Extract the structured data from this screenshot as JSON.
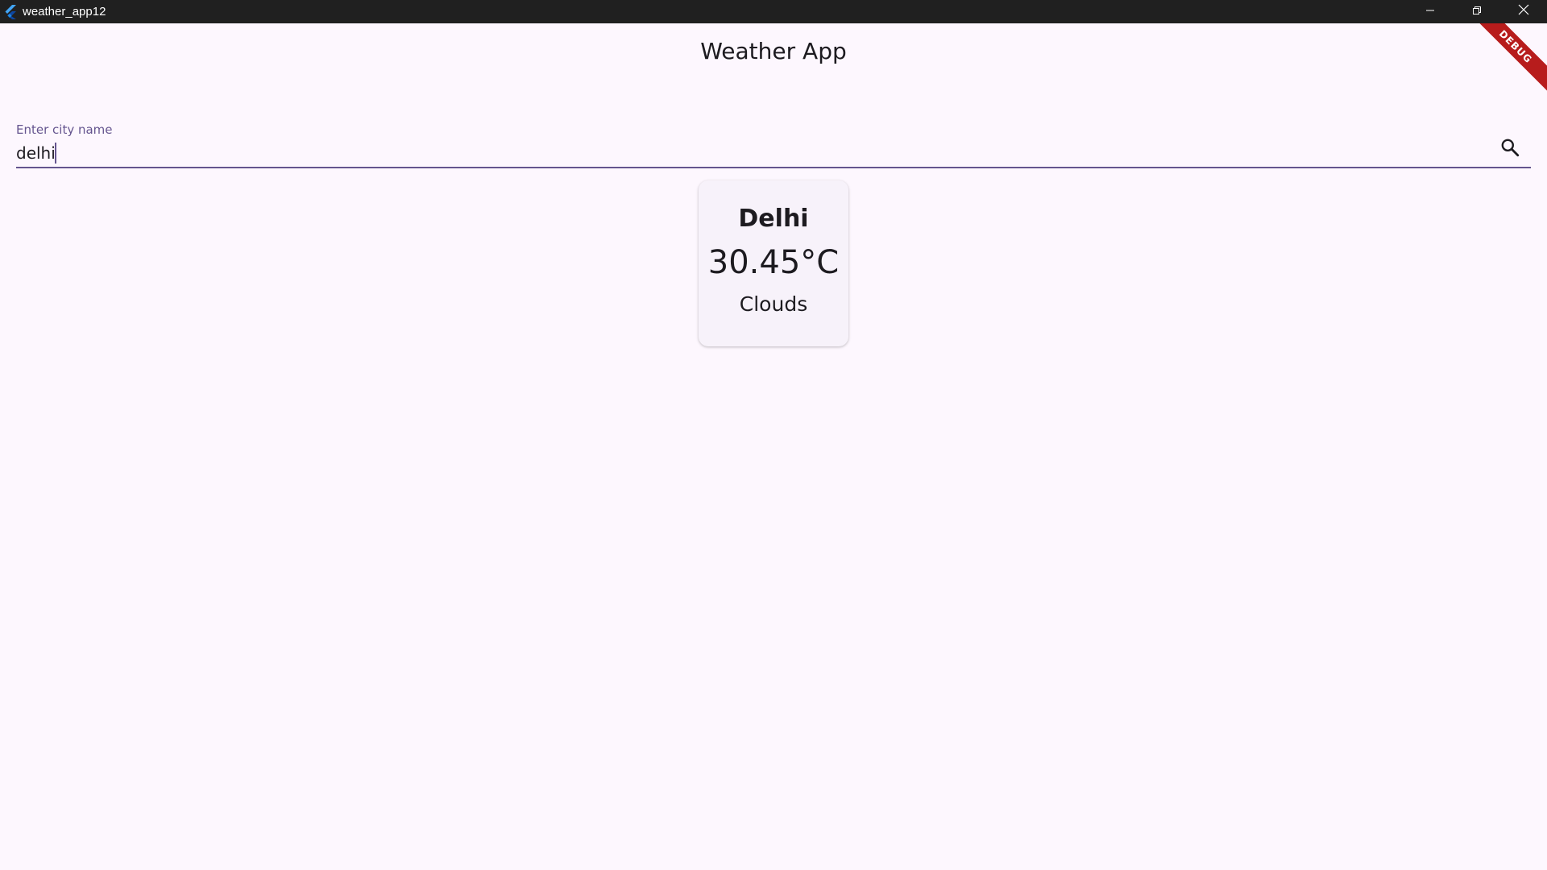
{
  "window": {
    "title": "weather_app12",
    "app_icon": "flutter-logo-icon",
    "controls": [
      "minimize-icon",
      "restore-icon",
      "close-icon"
    ]
  },
  "appbar": {
    "title": "Weather App"
  },
  "debug_banner": {
    "label": "DEBUG",
    "color": "#b71c1c"
  },
  "search": {
    "label": "Enter city name",
    "value": "delhi",
    "icon": "search-icon",
    "accent": "#65558f"
  },
  "weather_card": {
    "city": "Delhi",
    "temperature": "30.45°C",
    "condition": "Clouds"
  },
  "colors": {
    "background": "#fdf7fe",
    "card": "#f7f2fa",
    "titlebar": "#202020",
    "text": "#1d1b20"
  }
}
